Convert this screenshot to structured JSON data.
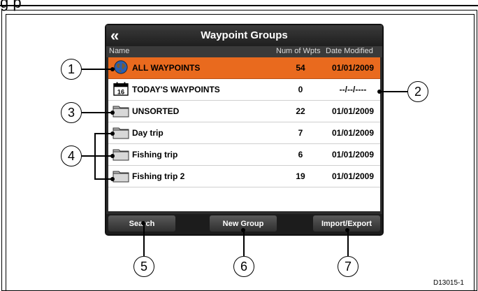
{
  "page_fragment_text": "g p",
  "screen": {
    "title": "Waypoint Groups",
    "back_symbol": "«",
    "columns": {
      "name": "Name",
      "num": "Num of Wpts",
      "date": "Date Modified"
    },
    "rows": [
      {
        "name": "ALL WAYPOINTS",
        "num": "54",
        "date": "01/01/2009",
        "icon": "globe-icon",
        "selected": true
      },
      {
        "name": "TODAY'S WAYPOINTS",
        "num": "0",
        "date": "--/--/----",
        "icon": "calendar-icon",
        "calendar_day": "16"
      },
      {
        "name": "UNSORTED",
        "num": "22",
        "date": "01/01/2009",
        "icon": "folder-icon"
      },
      {
        "name": "Day trip",
        "num": "7",
        "date": "01/01/2009",
        "icon": "folder-icon"
      },
      {
        "name": "Fishing trip",
        "num": "6",
        "date": "01/01/2009",
        "icon": "folder-icon"
      },
      {
        "name": "Fishing trip 2",
        "num": "19",
        "date": "01/01/2009",
        "icon": "folder-icon"
      }
    ],
    "softkeys": {
      "search": "Search",
      "new_group": "New Group",
      "import_export": "Import/Export"
    }
  },
  "callouts": [
    "1",
    "2",
    "3",
    "4",
    "5",
    "6",
    "7"
  ],
  "doc_id": "D13015-1",
  "colors": {
    "selected_row": "#e96a1e",
    "screen_frame": "#2b2b2b"
  }
}
